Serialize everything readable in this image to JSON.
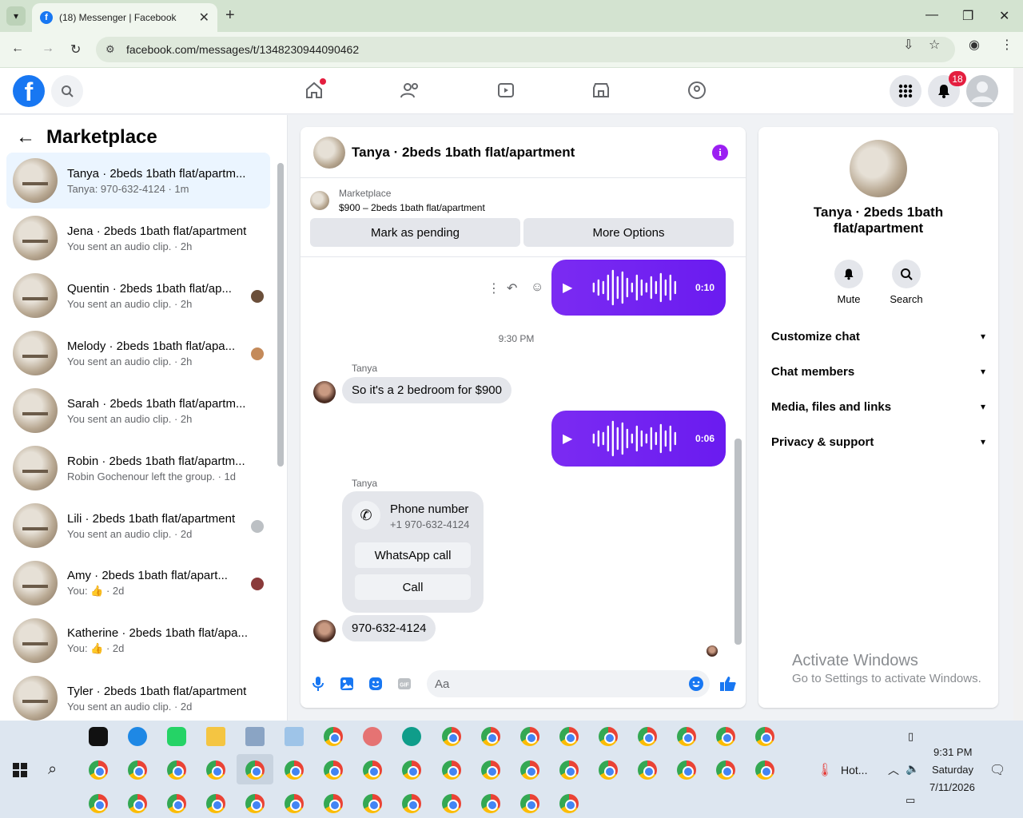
{
  "browser": {
    "tab_title": "(18) Messenger | Facebook",
    "url": "facebook.com/messages/t/1348230944090462"
  },
  "fb_header": {
    "notifications_count": "18"
  },
  "left_panel": {
    "title": "Marketplace",
    "conversations": [
      {
        "name": "Tanya · 2beds 1bath flat/apartm...",
        "sub": "Tanya: 970-632-4124 · 1m",
        "active": true
      },
      {
        "name": "Jena · 2beds 1bath flat/apartment",
        "sub": "You sent an audio clip. · 2h"
      },
      {
        "name": "Quentin · 2beds 1bath flat/ap...",
        "sub": "You sent an audio clip. · 2h"
      },
      {
        "name": "Melody · 2beds 1bath flat/apa...",
        "sub": "You sent an audio clip. · 2h"
      },
      {
        "name": "Sarah · 2beds 1bath flat/apartm...",
        "sub": "You sent an audio clip. · 2h"
      },
      {
        "name": "Robin · 2beds 1bath flat/apartm...",
        "sub": "Robin Gochenour left the group. · 1d"
      },
      {
        "name": "Lili · 2beds 1bath flat/apartment",
        "sub": "You sent an audio clip. · 2d"
      },
      {
        "name": "Amy · 2beds 1bath flat/apart...",
        "sub": "You: 👍 · 2d"
      },
      {
        "name": "Katherine · 2beds 1bath flat/apa...",
        "sub": "You: 👍 · 2d"
      },
      {
        "name": "Tyler · 2beds 1bath flat/apartment",
        "sub": "You sent an audio clip. · 2d"
      }
    ]
  },
  "chat": {
    "title": "Tanya · 2beds 1bath flat/apartment",
    "marketplace_label": "Marketplace",
    "listing": "$900 – 2beds 1bath flat/apartment",
    "mark_pending": "Mark as pending",
    "more_options": "More Options",
    "audio1_duration": "0:10",
    "timestamp": "9:30 PM",
    "sender1": "Tanya",
    "msg1": "So it's a 2 bedroom for $900",
    "audio2_duration": "0:06",
    "sender2": "Tanya",
    "phone_title": "Phone number",
    "phone_number": "+1 970-632-4124",
    "whatsapp_call": "WhatsApp call",
    "call": "Call",
    "msg2": "970-632-4124",
    "composer_placeholder": "Aa"
  },
  "right_panel": {
    "name": "Tanya · 2beds 1bath flat/apartment",
    "mute": "Mute",
    "search": "Search",
    "sections": [
      "Customize chat",
      "Chat members",
      "Media, files and links",
      "Privacy & support"
    ],
    "activate_title": "Activate Windows",
    "activate_sub": "Go to Settings to activate Windows."
  },
  "taskbar": {
    "weather": "Hot...",
    "time": "9:31 PM",
    "day": "Saturday",
    "date": "7/11/2026"
  }
}
